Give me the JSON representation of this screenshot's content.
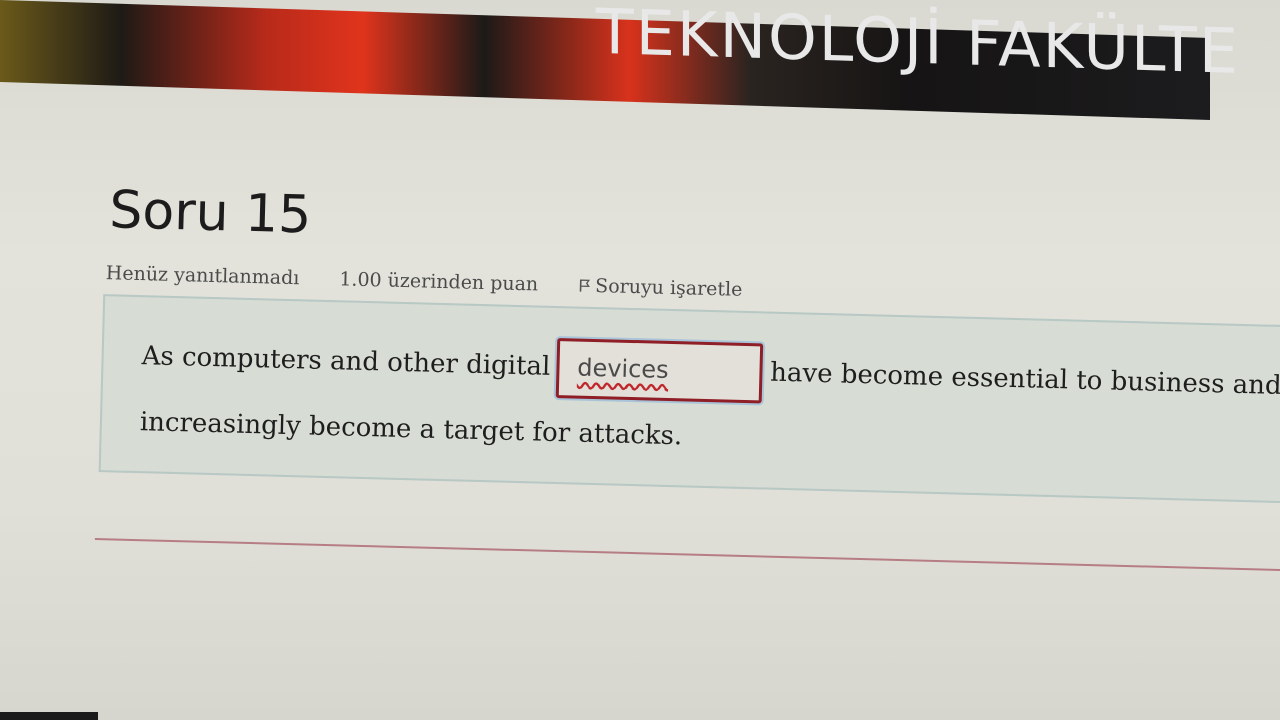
{
  "banner": {
    "text": "TEKNOLOJİ FAKÜLTE"
  },
  "question": {
    "title": "Soru 15",
    "status": "Henüz yanıtlanmadı",
    "points": "1.00 üzerinden puan",
    "flag_label": "Soruyu işaretle",
    "text_before": "As computers and other digital",
    "answer_value": "devices",
    "text_after": "have become essential to business and c",
    "text_line2": "increasingly become a target for attacks."
  },
  "colors": {
    "input_border": "#8f1e26",
    "divider": "#b77d84",
    "question_box": "#d7dcd4"
  }
}
